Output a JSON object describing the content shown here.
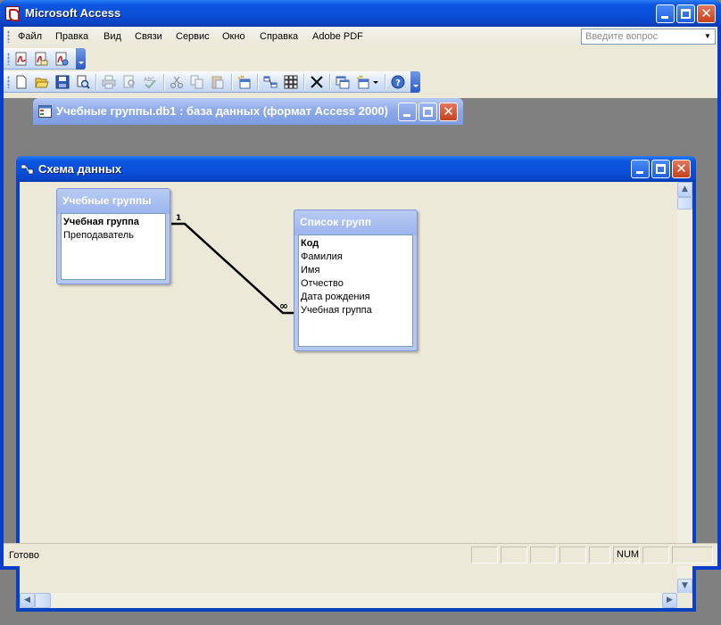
{
  "app": {
    "title": "Microsoft Access",
    "icon": "access-app-icon"
  },
  "menu": {
    "items": [
      "Файл",
      "Правка",
      "Вид",
      "Связи",
      "Сервис",
      "Окно",
      "Справка",
      "Adobe PDF"
    ],
    "help_placeholder": "Введите вопрос"
  },
  "toolbar_pdf": {
    "icons": [
      "convert-to-pdf-icon",
      "convert-and-email-pdf-icon",
      "convert-and-review-pdf-icon"
    ]
  },
  "toolbar_relationships": {
    "icons": [
      "new-icon",
      "open-icon",
      "save-icon",
      "file-search-icon",
      "print-icon",
      "print-preview-icon",
      "spelling-icon",
      "cut-icon",
      "copy-icon",
      "paste-icon",
      "show-table-icon",
      "show-direct-icon",
      "show-all-icon",
      "delete-icon",
      "database-window-icon",
      "new-object-icon",
      "help-icon"
    ]
  },
  "database_window": {
    "title": "Учебные группы.db1 : база данных (формат Access 2000)"
  },
  "schema_window": {
    "title": "Схема данных",
    "tables": [
      {
        "name": "Учебные группы",
        "fields": [
          {
            "label": "Учебная группа",
            "key": true
          },
          {
            "label": "Преподаватель",
            "key": false
          }
        ]
      },
      {
        "name": "Список групп",
        "fields": [
          {
            "label": "Код",
            "key": true
          },
          {
            "label": "Фамилия",
            "key": false
          },
          {
            "label": "Имя",
            "key": false
          },
          {
            "label": "Отчество",
            "key": false
          },
          {
            "label": "Дата рождения",
            "key": false
          },
          {
            "label": "Учебная группа",
            "key": false
          }
        ]
      }
    ],
    "relationship": {
      "from": "Учебные группы.Учебная группа",
      "to": "Список групп.Учебная группа",
      "one_label": "1",
      "many_label": "∞"
    }
  },
  "status": {
    "text": "Готово",
    "num_indicator": "NUM"
  }
}
